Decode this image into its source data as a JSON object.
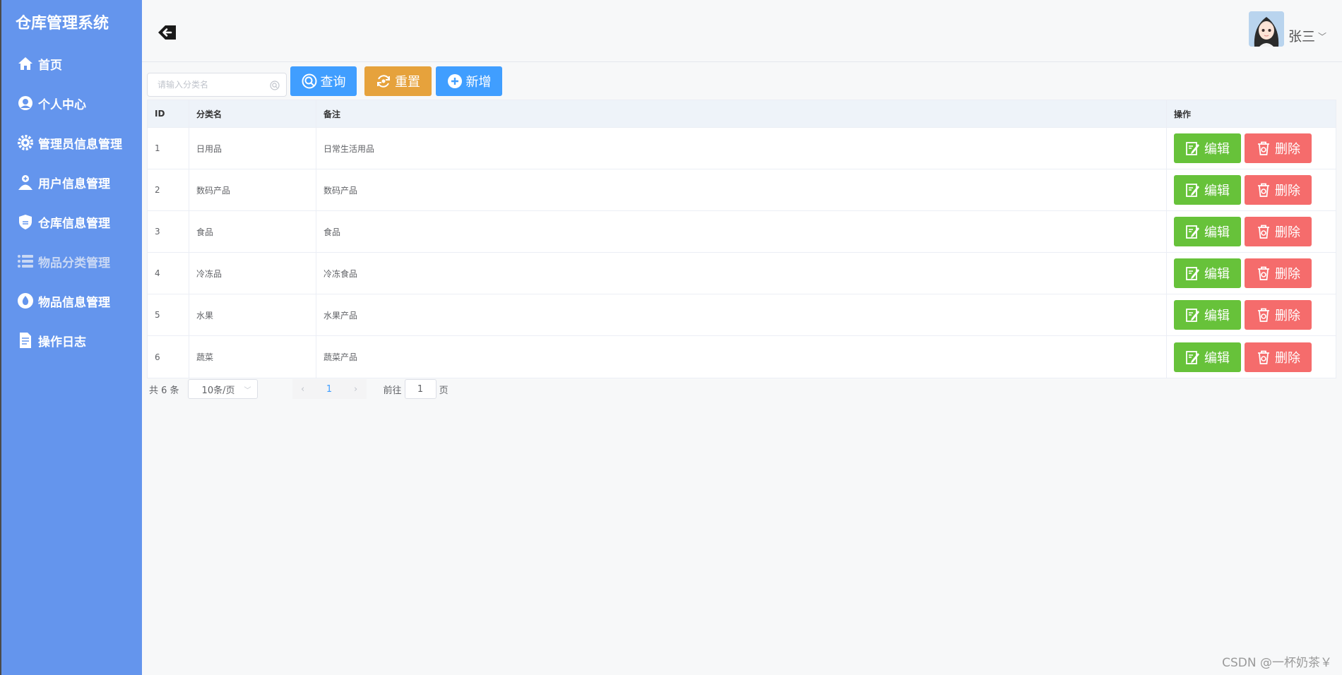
{
  "sidebar": {
    "title": "仓库管理系统",
    "items": [
      {
        "label": "首页",
        "icon": "home-icon"
      },
      {
        "label": "个人中心",
        "icon": "user-circle-icon"
      },
      {
        "label": "管理员信息管理",
        "icon": "gear-icon"
      },
      {
        "label": "用户信息管理",
        "icon": "user-add-icon"
      },
      {
        "label": "仓库信息管理",
        "icon": "shield-icon"
      },
      {
        "label": "物品分类管理",
        "icon": "list-icon",
        "active": true
      },
      {
        "label": "物品信息管理",
        "icon": "drop-icon"
      },
      {
        "label": "操作日志",
        "icon": "document-icon"
      }
    ]
  },
  "header": {
    "username": "张三"
  },
  "toolbar": {
    "search_placeholder": "请输入分类名",
    "search_value": "",
    "query_label": "查询",
    "reset_label": "重置",
    "add_label": "新增"
  },
  "table": {
    "columns": [
      "ID",
      "分类名",
      "备注",
      "操作"
    ],
    "rows": [
      {
        "id": "1",
        "name": "日用品",
        "remark": "日常生活用品"
      },
      {
        "id": "2",
        "name": "数码产品",
        "remark": "数码产品"
      },
      {
        "id": "3",
        "name": "食品",
        "remark": "食品"
      },
      {
        "id": "4",
        "name": "冷冻品",
        "remark": "冷冻食品"
      },
      {
        "id": "5",
        "name": "水果",
        "remark": "水果产品"
      },
      {
        "id": "6",
        "name": "蔬菜",
        "remark": "蔬菜产品"
      }
    ],
    "edit_label": "编辑",
    "delete_label": "删除"
  },
  "pagination": {
    "total": "共 6 条",
    "page_size": "10条/页",
    "current_page": "1",
    "goto_prefix": "前往",
    "goto_value": "1",
    "goto_suffix": "页"
  },
  "watermark": "CSDN @一杯奶茶￥",
  "colors": {
    "sidebar": "#6495ed",
    "primary": "#409eff",
    "warning": "#e6a23c",
    "success": "#67c23a",
    "danger": "#f56c6c"
  }
}
